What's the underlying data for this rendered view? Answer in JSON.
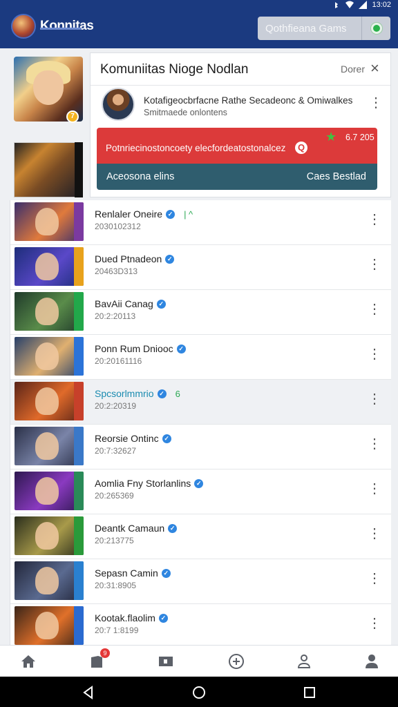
{
  "status": {
    "time": "13:02"
  },
  "header": {
    "app_name": "Konnitas",
    "search_label": "Qothfieana Gams"
  },
  "profile": {
    "badge": "7"
  },
  "card": {
    "title": "Komuniitas Nioge Nodlan",
    "close_label": "Dorer",
    "sub_title": "Kotafigeocbrfacne Rathe Secadeonc & Omiwalkes",
    "sub_meta": "Smitmaede onlontens",
    "alert_text": "Potnriecinostoncoety elecfordeatostonalcez",
    "alert_score": "6.7 205",
    "action_left": "Aceosona elins",
    "action_right": "Caes Bestlad"
  },
  "list": {
    "items": [
      {
        "title": "Renlaler Oneire",
        "date": "2030102312",
        "extra": "|      ^",
        "colors": [
          "#3a2e6c",
          "#e07a3c",
          "#7b3aa0"
        ]
      },
      {
        "title": "Dued Ptnadeon",
        "date": "20463D313",
        "extra": "",
        "colors": [
          "#1d2d7a",
          "#5a48c8",
          "#e8a21c"
        ]
      },
      {
        "title": "BavAii Canag",
        "date": "20:2:20113",
        "extra": "",
        "colors": [
          "#1f3a2a",
          "#5a8c4a",
          "#22a84a"
        ]
      },
      {
        "title": "Ponn Rum Dniooc",
        "date": "20:20161116",
        "extra": "",
        "colors": [
          "#27406a",
          "#e0b070",
          "#2b73d8"
        ]
      },
      {
        "title": "Spcsorlmmrio",
        "date": "20:2:20319",
        "extra": "6",
        "colors": [
          "#5a2418",
          "#e06a2a",
          "#c7402a"
        ]
      },
      {
        "title": "Reorsie Ontinc",
        "date": "20:7:32627",
        "extra": "",
        "colors": [
          "#2a3048",
          "#7a84a8",
          "#3a78c8"
        ]
      },
      {
        "title": "Aomlia Fny Storlanlins",
        "date": "20:265369",
        "extra": "",
        "colors": [
          "#2e1850",
          "#8a3ac0",
          "#2a8a58"
        ]
      },
      {
        "title": "Deantk Camaun",
        "date": "20:213775",
        "extra": "",
        "colors": [
          "#2a2e1c",
          "#a89a4a",
          "#2a9a3a"
        ]
      },
      {
        "title": "Sepasn Camin",
        "date": "20:31:8905",
        "extra": "",
        "colors": [
          "#22263a",
          "#5a6a90",
          "#2a80d0"
        ]
      },
      {
        "title": "Kootak.flaolim",
        "date": "20:7 1:8199",
        "extra": "",
        "colors": [
          "#3a2418",
          "#e0702a",
          "#2a6ad0"
        ]
      }
    ]
  },
  "nav": {
    "badge": "9"
  }
}
